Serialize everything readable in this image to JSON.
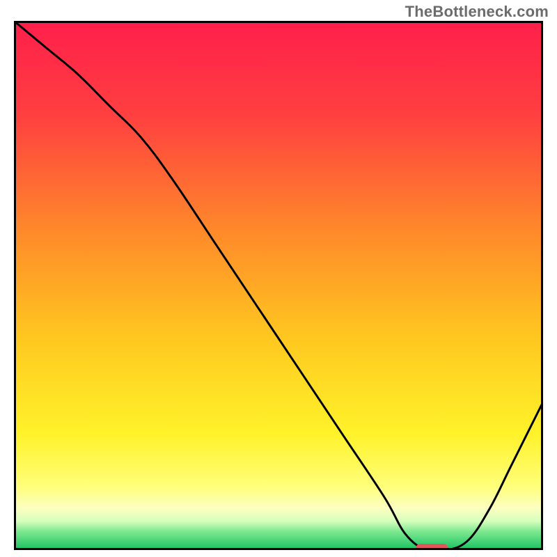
{
  "watermark": "TheBottleneck.com",
  "chart_data": {
    "type": "line",
    "title": "",
    "xlabel": "",
    "ylabel": "",
    "xlim": [
      0,
      100
    ],
    "ylim": [
      0,
      100
    ],
    "x": [
      0,
      6,
      12,
      18,
      24,
      30,
      38,
      46,
      54,
      62,
      70,
      74,
      78,
      82,
      86,
      90,
      94,
      100
    ],
    "values": [
      100,
      95,
      90,
      84,
      78,
      70,
      58,
      46,
      34,
      22,
      10,
      3,
      0,
      0,
      2,
      8,
      16,
      28
    ],
    "marker": {
      "x_start": 76,
      "x_end": 82,
      "y": 0.4,
      "color": "#e0575b"
    },
    "background_gradient": {
      "stops": [
        {
          "offset": 0.0,
          "color": "#ff1f4b"
        },
        {
          "offset": 0.18,
          "color": "#ff4040"
        },
        {
          "offset": 0.4,
          "color": "#ff8a2a"
        },
        {
          "offset": 0.6,
          "color": "#ffc820"
        },
        {
          "offset": 0.78,
          "color": "#fff22a"
        },
        {
          "offset": 0.88,
          "color": "#ffff7a"
        },
        {
          "offset": 0.92,
          "color": "#fcffc0"
        },
        {
          "offset": 0.945,
          "color": "#d8ffbd"
        },
        {
          "offset": 0.965,
          "color": "#7de890"
        },
        {
          "offset": 1.0,
          "color": "#17c160"
        }
      ]
    },
    "frame_color": "#000000",
    "curve_color": "#000000"
  }
}
